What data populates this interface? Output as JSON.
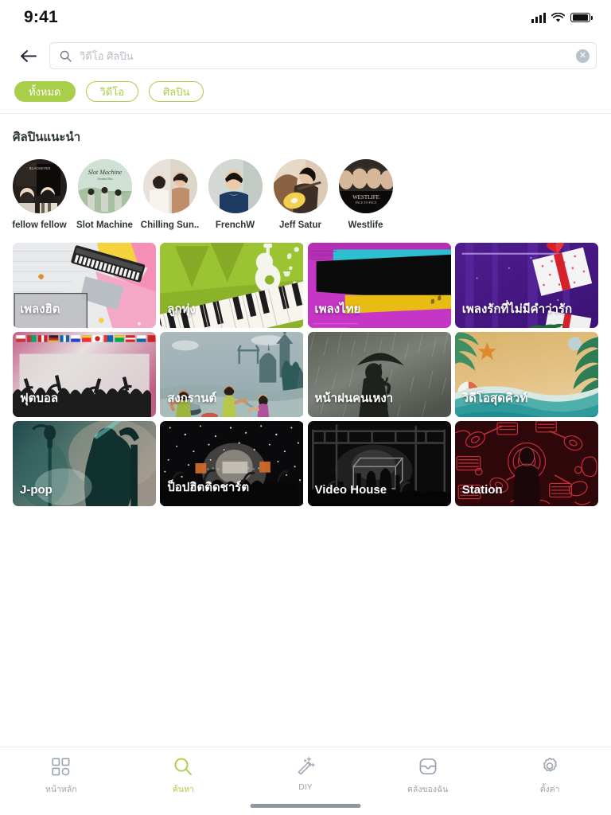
{
  "status_bar": {
    "time": "9:41",
    "signal_icon": "cellular-signal-icon",
    "wifi_icon": "wifi-icon",
    "battery_icon": "battery-full-icon"
  },
  "search": {
    "back_icon": "back-arrow-icon",
    "search_icon": "search-icon",
    "placeholder": "วิดีโอ ศิลปิน",
    "value": "",
    "clear_icon": "clear-circle-icon",
    "clear_label": "✕"
  },
  "filters": [
    {
      "label": "ทั้งหมด",
      "active": true
    },
    {
      "label": "วิดีโอ",
      "active": false
    },
    {
      "label": "ศิลปิน",
      "active": false
    }
  ],
  "artists_section": {
    "title": "ศิลปินแนะนำ",
    "items": [
      {
        "name": "fellow fellow"
      },
      {
        "name": "Slot Machine"
      },
      {
        "name": "Chilling Sun.."
      },
      {
        "name": "FrenchW"
      },
      {
        "name": "Jeff Satur"
      },
      {
        "name": "Westlife"
      }
    ]
  },
  "categories": [
    {
      "label": "เพลงฮิต",
      "art": "keyboard-collage"
    },
    {
      "label": "ลูกทุ่ง",
      "art": "guitar-piano-green"
    },
    {
      "label": "เพลงไทย",
      "art": "magenta-black-shapes"
    },
    {
      "label": "เพลงรักที่ไม่มีคำว่ารัก",
      "art": "purple-gift"
    },
    {
      "label": "ฟุตบอล",
      "art": "flags-crowd"
    },
    {
      "label": "สงกรานต์",
      "art": "songkran-temple"
    },
    {
      "label": "หน้าฝนคนเหงา",
      "art": "rain-umbrella"
    },
    {
      "label": "วิดีโอสุดคิวท์",
      "art": "beach-waves"
    },
    {
      "label": "J-pop",
      "art": "stage-singer-teal"
    },
    {
      "label": "ป็อปฮิตติดชาร์ต",
      "art": "concert-confetti"
    },
    {
      "label": "Video House",
      "art": "dark-stage"
    },
    {
      "label": "Station",
      "art": "red-neon-instruments"
    }
  ],
  "tabbar": [
    {
      "label": "หน้าหลัก",
      "icon": "home-grid-icon",
      "active": false
    },
    {
      "label": "ค้นหา",
      "icon": "search-icon",
      "active": true
    },
    {
      "label": "DIY",
      "icon": "magic-wand-icon",
      "active": false
    },
    {
      "label": "คลังของฉัน",
      "icon": "library-box-icon",
      "active": false
    },
    {
      "label": "ตั้งค่า",
      "icon": "gear-icon",
      "active": false
    }
  ],
  "colors": {
    "accent": "#a9ce4a",
    "inactive": "#9aa5b1",
    "text": "#2d3436"
  }
}
